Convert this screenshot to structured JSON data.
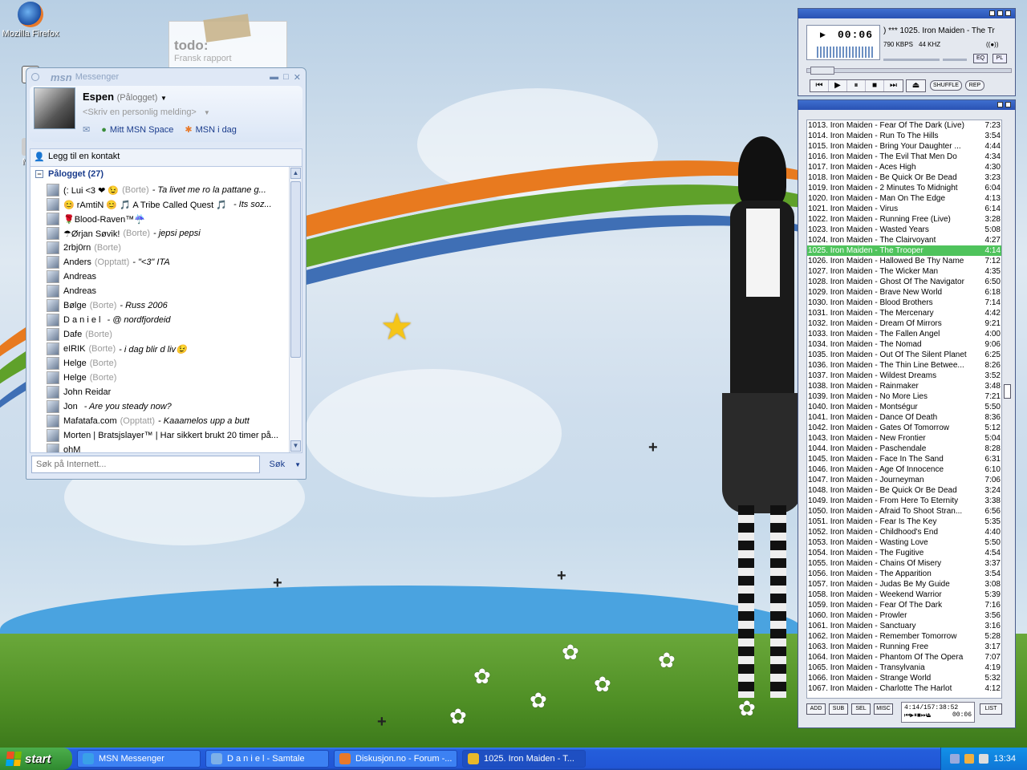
{
  "desktop": {
    "icons": [
      {
        "label": "Mozilla Firefox",
        "icon": "firefox-icon"
      },
      {
        "label": "Wi",
        "icon": "shortcut-icon"
      },
      {
        "label": "Mes",
        "icon": "messenger-icon"
      }
    ],
    "todo": {
      "title": "todo:",
      "line": "Fransk rapport"
    }
  },
  "msn": {
    "title": "Messenger",
    "logo": "msn",
    "user": {
      "name": "Espen",
      "status": "(Pålogget)"
    },
    "personal_message_placeholder": "<Skriv en personlig melding>",
    "links": {
      "space": "Mitt MSN Space",
      "today": "MSN i dag"
    },
    "add_contact": "Legg til en kontakt",
    "group": {
      "label": "Pålogget (27)"
    },
    "contacts": [
      {
        "name": "(: Lui <3 ❤ 😉",
        "status": "(Borte)",
        "msg": "- Ta livet me ro la pattane g..."
      },
      {
        "name": "😊 rAmtiN 😊 🎵 A Tribe Called Quest 🎵",
        "status": "",
        "msg": "- Its soz..."
      },
      {
        "name": "🌹Blood-Raven™☔",
        "status": "",
        "msg": ""
      },
      {
        "name": "☂Ørjan Søvik!",
        "status": "(Borte)",
        "msg": "- jepsi pepsi"
      },
      {
        "name": "2rbj0rn",
        "status": "(Borte)",
        "msg": ""
      },
      {
        "name": "Anders",
        "status": "(Opptatt)",
        "msg": "- \"<3\" ITA"
      },
      {
        "name": "Andreas",
        "status": "",
        "msg": ""
      },
      {
        "name": "Andreas",
        "status": "",
        "msg": ""
      },
      {
        "name": "Bølge",
        "status": "(Borte)",
        "msg": "- Russ 2006"
      },
      {
        "name": "D a n i e l",
        "status": "",
        "msg": "- @ nordfjordeid"
      },
      {
        "name": "Dafe",
        "status": "(Borte)",
        "msg": ""
      },
      {
        "name": "eIRIK",
        "status": "(Borte)",
        "msg": "- i dag blir d liv😉"
      },
      {
        "name": "Helge",
        "status": "(Borte)",
        "msg": ""
      },
      {
        "name": "Helge",
        "status": "(Borte)",
        "msg": ""
      },
      {
        "name": "John Reidar",
        "status": "",
        "msg": ""
      },
      {
        "name": "Jon",
        "status": "",
        "msg": "- Are you steady now?"
      },
      {
        "name": "Mafatafa.com",
        "status": "(Opptatt)",
        "msg": "- Kaaamelos upp a butt"
      },
      {
        "name": "Morten | Bratsjslayer™ | Har sikkert brukt 20 timer på...",
        "status": "",
        "msg": ""
      },
      {
        "name": "ohM",
        "status": "",
        "msg": ""
      }
    ],
    "search": {
      "placeholder": "Søk på Internett...",
      "button": "Søk"
    }
  },
  "winamp": {
    "time": "00:06",
    "song": ") *** 1025. Iron Maiden - The Tr",
    "kbps": "790 KBPS",
    "khz": "44 KHZ",
    "mono": "((●))",
    "buttons": {
      "eq": "EQ",
      "pl": "PL",
      "shuffle": "SHUFFLE",
      "rep": "REP"
    },
    "controls": [
      "⏮",
      "▶",
      "⏸",
      "■",
      "⏭"
    ],
    "eject": "⏏",
    "playlist": [
      {
        "t": "1013. Iron Maiden - Fear Of The Dark (Live)",
        "d": "7:23"
      },
      {
        "t": "1014. Iron Maiden - Run To The Hills",
        "d": "3:54"
      },
      {
        "t": "1015. Iron Maiden - Bring Your Daughter ...",
        "d": "4:44"
      },
      {
        "t": "1016. Iron Maiden - The Evil That Men Do",
        "d": "4:34"
      },
      {
        "t": "1017. Iron Maiden - Aces High",
        "d": "4:30"
      },
      {
        "t": "1018. Iron Maiden - Be Quick Or Be Dead",
        "d": "3:23"
      },
      {
        "t": "1019. Iron Maiden - 2 Minutes To Midnight",
        "d": "6:04"
      },
      {
        "t": "1020. Iron Maiden - Man On The Edge",
        "d": "4:13"
      },
      {
        "t": "1021. Iron Maiden - Virus",
        "d": "6:14"
      },
      {
        "t": "1022. Iron Maiden - Running Free (Live)",
        "d": "3:28"
      },
      {
        "t": "1023. Iron Maiden - Wasted Years",
        "d": "5:08"
      },
      {
        "t": "1024. Iron Maiden - The Clairvoyant",
        "d": "4:27"
      },
      {
        "t": "1025. Iron Maiden - The Trooper",
        "d": "4:14"
      },
      {
        "t": "1026. Iron Maiden - Hallowed Be Thy Name",
        "d": "7:12"
      },
      {
        "t": "1027. Iron Maiden - The Wicker Man",
        "d": "4:35"
      },
      {
        "t": "1028. Iron Maiden - Ghost Of The Navigator",
        "d": "6:50"
      },
      {
        "t": "1029. Iron Maiden - Brave New World",
        "d": "6:18"
      },
      {
        "t": "1030. Iron Maiden - Blood Brothers",
        "d": "7:14"
      },
      {
        "t": "1031. Iron Maiden - The Mercenary",
        "d": "4:42"
      },
      {
        "t": "1032. Iron Maiden - Dream Of Mirrors",
        "d": "9:21"
      },
      {
        "t": "1033. Iron Maiden - The Fallen Angel",
        "d": "4:00"
      },
      {
        "t": "1034. Iron Maiden - The Nomad",
        "d": "9:06"
      },
      {
        "t": "1035. Iron Maiden - Out Of The Silent Planet",
        "d": "6:25"
      },
      {
        "t": "1036. Iron Maiden - The Thin Line Betwee...",
        "d": "8:26"
      },
      {
        "t": "1037. Iron Maiden - Wildest Dreams",
        "d": "3:52"
      },
      {
        "t": "1038. Iron Maiden - Rainmaker",
        "d": "3:48"
      },
      {
        "t": "1039. Iron Maiden - No More Lies",
        "d": "7:21"
      },
      {
        "t": "1040. Iron Maiden - Montségur",
        "d": "5:50"
      },
      {
        "t": "1041. Iron Maiden - Dance Of Death",
        "d": "8:36"
      },
      {
        "t": "1042. Iron Maiden - Gates Of Tomorrow",
        "d": "5:12"
      },
      {
        "t": "1043. Iron Maiden - New Frontier",
        "d": "5:04"
      },
      {
        "t": "1044. Iron Maiden - Paschendale",
        "d": "8:28"
      },
      {
        "t": "1045. Iron Maiden - Face In The Sand",
        "d": "6:31"
      },
      {
        "t": "1046. Iron Maiden - Age Of Innocence",
        "d": "6:10"
      },
      {
        "t": "1047. Iron Maiden - Journeyman",
        "d": "7:06"
      },
      {
        "t": "1048. Iron Maiden - Be Quick Or Be Dead",
        "d": "3:24"
      },
      {
        "t": "1049. Iron Maiden - From Here To Eternity",
        "d": "3:38"
      },
      {
        "t": "1050. Iron Maiden - Afraid To Shoot Stran...",
        "d": "6:56"
      },
      {
        "t": "1051. Iron Maiden - Fear Is The Key",
        "d": "5:35"
      },
      {
        "t": "1052. Iron Maiden - Childhood's End",
        "d": "4:40"
      },
      {
        "t": "1053. Iron Maiden - Wasting Love",
        "d": "5:50"
      },
      {
        "t": "1054. Iron Maiden - The Fugitive",
        "d": "4:54"
      },
      {
        "t": "1055. Iron Maiden - Chains Of Misery",
        "d": "3:37"
      },
      {
        "t": "1056. Iron Maiden - The Apparition",
        "d": "3:54"
      },
      {
        "t": "1057. Iron Maiden - Judas Be My Guide",
        "d": "3:08"
      },
      {
        "t": "1058. Iron Maiden - Weekend Warrior",
        "d": "5:39"
      },
      {
        "t": "1059. Iron Maiden - Fear Of The Dark",
        "d": "7:16"
      },
      {
        "t": "1060. Iron Maiden - Prowler",
        "d": "3:56"
      },
      {
        "t": "1061. Iron Maiden - Sanctuary",
        "d": "3:16"
      },
      {
        "t": "1062. Iron Maiden - Remember Tomorrow",
        "d": "5:28"
      },
      {
        "t": "1063. Iron Maiden - Running Free",
        "d": "3:17"
      },
      {
        "t": "1064. Iron Maiden - Phantom Of The Opera",
        "d": "7:07"
      },
      {
        "t": "1065. Iron Maiden - Transylvania",
        "d": "4:19"
      },
      {
        "t": "1066. Iron Maiden - Strange World",
        "d": "5:32"
      },
      {
        "t": "1067. Iron Maiden - Charlotte The Harlot",
        "d": "4:12"
      }
    ],
    "current_index": 12,
    "pl_buttons": [
      "ADD",
      "SUB",
      "SEL",
      "MISC",
      "LIST"
    ],
    "pl_info": {
      "line1": "4:14/157:38:52",
      "line2": "00:06"
    }
  },
  "taskbar": {
    "start": "start",
    "items": [
      {
        "label": "MSN Messenger",
        "icon": "msn-icon",
        "color": "#3aa0e8"
      },
      {
        "label": "D a n i e l - Samtale",
        "icon": "chat-icon",
        "color": "#7db0e8"
      },
      {
        "label": "Diskusjon.no - Forum -...",
        "icon": "firefox-icon",
        "color": "#e8792a"
      },
      {
        "label": "1025. Iron Maiden - T...",
        "icon": "winamp-icon",
        "color": "#e8b82a"
      }
    ],
    "clock": "13:34"
  }
}
